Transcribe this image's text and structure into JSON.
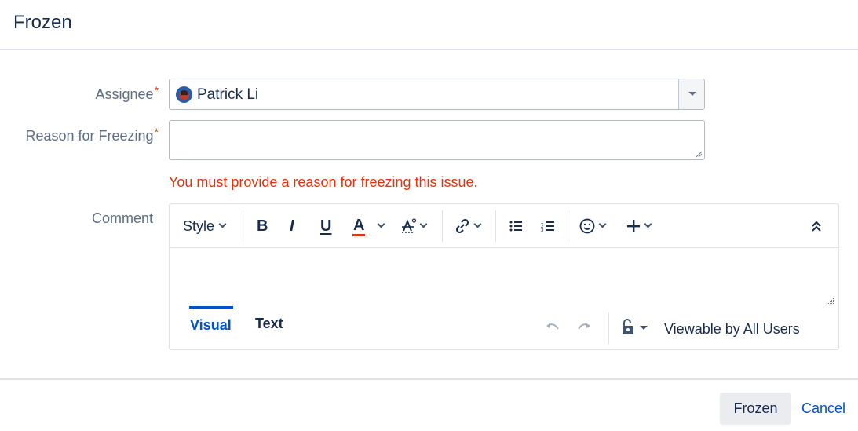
{
  "dialog": {
    "title": "Frozen"
  },
  "form": {
    "assignee": {
      "label": "Assignee",
      "required_mark": "*",
      "value": "Patrick Li"
    },
    "reason": {
      "label": "Reason for Freezing",
      "required_mark": "*",
      "value": "",
      "error": "You must provide a reason for freezing this issue."
    },
    "comment": {
      "label": "Comment",
      "toolbar": {
        "style_label": "Style",
        "bold": "B",
        "italic": "I",
        "underline": "U",
        "text_color": "A",
        "text_color_accent": "#de350b"
      },
      "tabs": {
        "visual": "Visual",
        "text": "Text",
        "active": "Visual"
      },
      "visibility": "Viewable by All Users"
    }
  },
  "footer": {
    "submit_label": "Frozen",
    "cancel_label": "Cancel"
  },
  "colors": {
    "link": "#0052cc",
    "error": "#de350b",
    "label": "#5e6c84",
    "text": "#172b4d"
  }
}
